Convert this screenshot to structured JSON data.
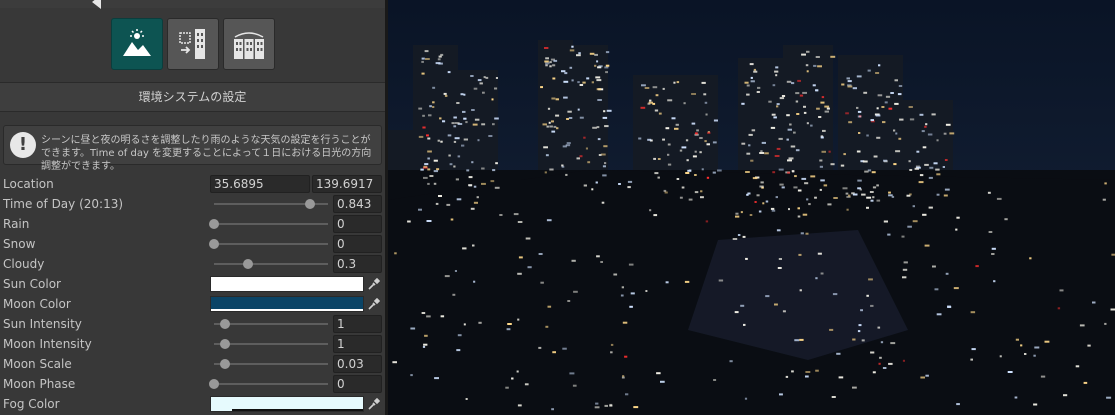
{
  "toolbar": {
    "tabs": [
      {
        "icon": "environment-icon",
        "active": true
      },
      {
        "icon": "building-convert-icon",
        "active": false
      },
      {
        "icon": "buildings-icon",
        "active": false
      }
    ]
  },
  "section": {
    "title": "環境システムの設定"
  },
  "help": {
    "text": "シーンに昼と夜の明るさを調整したり雨のような天気の設定を行うことができます。Time of day を変更することによって１日における日光の方向調整ができます。"
  },
  "fields": {
    "location": {
      "label": "Location",
      "lat": "35.6895",
      "lon": "139.6917"
    },
    "time_of_day": {
      "label": "Time of Day (20:13)",
      "value": "0.843",
      "fraction": 0.843
    },
    "rain": {
      "label": "Rain",
      "value": "0",
      "fraction": 0
    },
    "snow": {
      "label": "Snow",
      "value": "0",
      "fraction": 0
    },
    "cloudy": {
      "label": "Cloudy",
      "value": "0.3",
      "fraction": 0.3
    },
    "sun_color": {
      "label": "Sun Color",
      "color": "#ffffff"
    },
    "moon_color": {
      "label": "Moon Color",
      "color": "#0b4466"
    },
    "sun_intensity": {
      "label": "Sun Intensity",
      "value": "1",
      "fraction": 0.1
    },
    "moon_intensity": {
      "label": "Moon Intensity",
      "value": "1",
      "fraction": 0.1
    },
    "moon_scale": {
      "label": "Moon Scale",
      "value": "0.03",
      "fraction": 0.1
    },
    "moon_phase": {
      "label": "Moon Phase",
      "value": "0",
      "fraction": 0
    },
    "fog_color": {
      "label": "Fog Color",
      "color": "#e6fafd"
    }
  },
  "colors": {
    "accent": "#0d5452",
    "panel": "#383838",
    "field": "#2a2a2a"
  }
}
